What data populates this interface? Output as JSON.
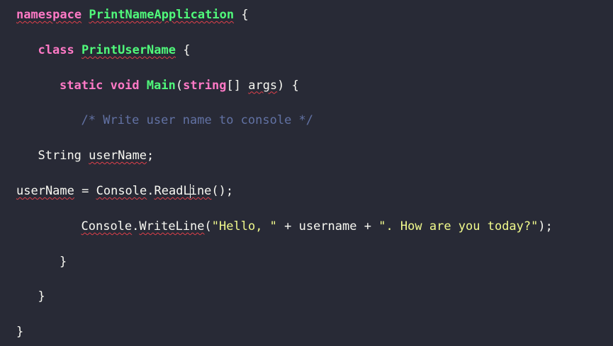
{
  "editor": {
    "lines": [
      {
        "indent": 0,
        "tokens": [
          {
            "text": "namespace",
            "cls": "kw",
            "squig": true
          },
          {
            "text": " ",
            "cls": "plain"
          },
          {
            "text": "PrintNameApplication",
            "cls": "cls",
            "squig": true
          },
          {
            "text": " {",
            "cls": "plain"
          }
        ]
      },
      {
        "indent": 1,
        "tokens": [
          {
            "text": "class",
            "cls": "kw"
          },
          {
            "text": " ",
            "cls": "plain"
          },
          {
            "text": "PrintUserName",
            "cls": "cls",
            "squig": true
          },
          {
            "text": " {",
            "cls": "plain"
          }
        ]
      },
      {
        "indent": 2,
        "tokens": [
          {
            "text": "static",
            "cls": "kw"
          },
          {
            "text": " ",
            "cls": "plain"
          },
          {
            "text": "void",
            "cls": "kw"
          },
          {
            "text": " ",
            "cls": "plain"
          },
          {
            "text": "Main",
            "cls": "fn"
          },
          {
            "text": "(",
            "cls": "plain"
          },
          {
            "text": "string",
            "cls": "kw"
          },
          {
            "text": "[] ",
            "cls": "plain"
          },
          {
            "text": "args",
            "cls": "plain",
            "squig": true
          },
          {
            "text": ") {",
            "cls": "plain"
          }
        ]
      },
      {
        "indent": 3,
        "tokens": [
          {
            "text": "/* Write user name to console */",
            "cls": "cmt"
          }
        ]
      },
      {
        "indent": 1,
        "tokens": [
          {
            "text": "String ",
            "cls": "plain"
          },
          {
            "text": "userName",
            "cls": "plain",
            "squig": true
          },
          {
            "text": ";",
            "cls": "plain"
          }
        ]
      },
      {
        "indent": 0,
        "tokens": [
          {
            "text": "userName",
            "cls": "plain",
            "squig": true
          },
          {
            "text": " = ",
            "cls": "plain"
          },
          {
            "text": "Console",
            "cls": "plain",
            "squig": true
          },
          {
            "text": ".",
            "cls": "plain"
          },
          {
            "text": "ReadL",
            "cls": "plain",
            "squig": true
          },
          {
            "caret": true
          },
          {
            "text": "ine",
            "cls": "plain",
            "squig": true
          },
          {
            "text": "();",
            "cls": "plain"
          }
        ]
      },
      {
        "indent": 3,
        "tokens": [
          {
            "text": "Console",
            "cls": "plain",
            "squig": true
          },
          {
            "text": ".",
            "cls": "plain"
          },
          {
            "text": "WriteLine",
            "cls": "plain",
            "squig": true
          },
          {
            "text": "(",
            "cls": "plain"
          },
          {
            "text": "\"Hello, \"",
            "cls": "str"
          },
          {
            "text": " + username + ",
            "cls": "plain"
          },
          {
            "text": "\". How are you today?\"",
            "cls": "str"
          },
          {
            "text": ");",
            "cls": "plain"
          }
        ]
      },
      {
        "indent": 2,
        "tokens": [
          {
            "text": "}",
            "cls": "plain"
          }
        ]
      },
      {
        "indent": 1,
        "tokens": [
          {
            "text": "}",
            "cls": "plain"
          }
        ]
      },
      {
        "indent": 0,
        "tokens": [
          {
            "text": "}",
            "cls": "plain"
          }
        ]
      }
    ]
  },
  "colors": {
    "background": "#282a36",
    "keyword": "#ff79c6",
    "class": "#50fa7b",
    "string": "#f1fa8c",
    "comment": "#6272a4",
    "text": "#f8f8f2",
    "spellcheck": "#e0404a"
  }
}
